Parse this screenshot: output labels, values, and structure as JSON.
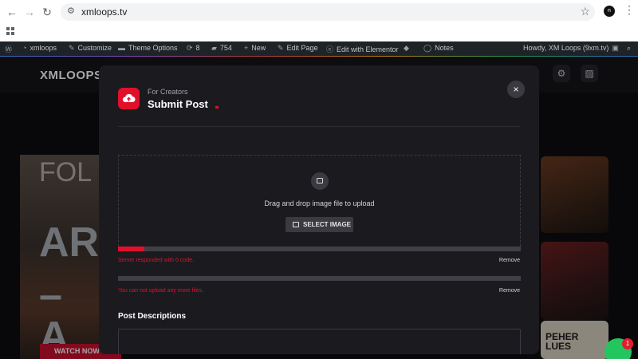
{
  "browser": {
    "url": "xmloops.tv",
    "profile_initial": "n",
    "icons": {
      "back": "back-arrow-icon",
      "forward": "forward-arrow-icon",
      "reload": "reload-icon",
      "star": "star-icon",
      "menu": "kebab-menu-icon",
      "apps": "apps-grid-icon"
    }
  },
  "adminbar": {
    "site_name": "xmloops",
    "customize": "Customize",
    "theme_options": "Theme Options",
    "updates_count": "8",
    "comments_count": "754",
    "new": "New",
    "edit_page": "Edit Page",
    "edit_elementor": "Edit with Elementor",
    "notes": "Notes",
    "howdy": "Howdy, XM Loops (9xm.tv)"
  },
  "site": {
    "logo": "XMLOOPS",
    "hero_text": [
      "FOL",
      "AR",
      "– A"
    ],
    "watch_now": "WATCH NOW",
    "thumb_caption": [
      "PEHER",
      "LUES"
    ],
    "chat_badge": "1"
  },
  "modal": {
    "eyebrow": "For Creators",
    "title": "Submit Post",
    "close_label": "×",
    "dropzone_text": "Drag and drop image file to upload",
    "select_button": "SELECT IMAGE",
    "uploads": [
      {
        "progress": 0.065,
        "error": "Server responded with 0 code.",
        "remove": "Remove"
      },
      {
        "progress": 0,
        "error": "You can not upload any more files.",
        "remove": "Remove"
      }
    ],
    "section_title": "Post Descriptions",
    "accent_color": "#e0102b"
  }
}
